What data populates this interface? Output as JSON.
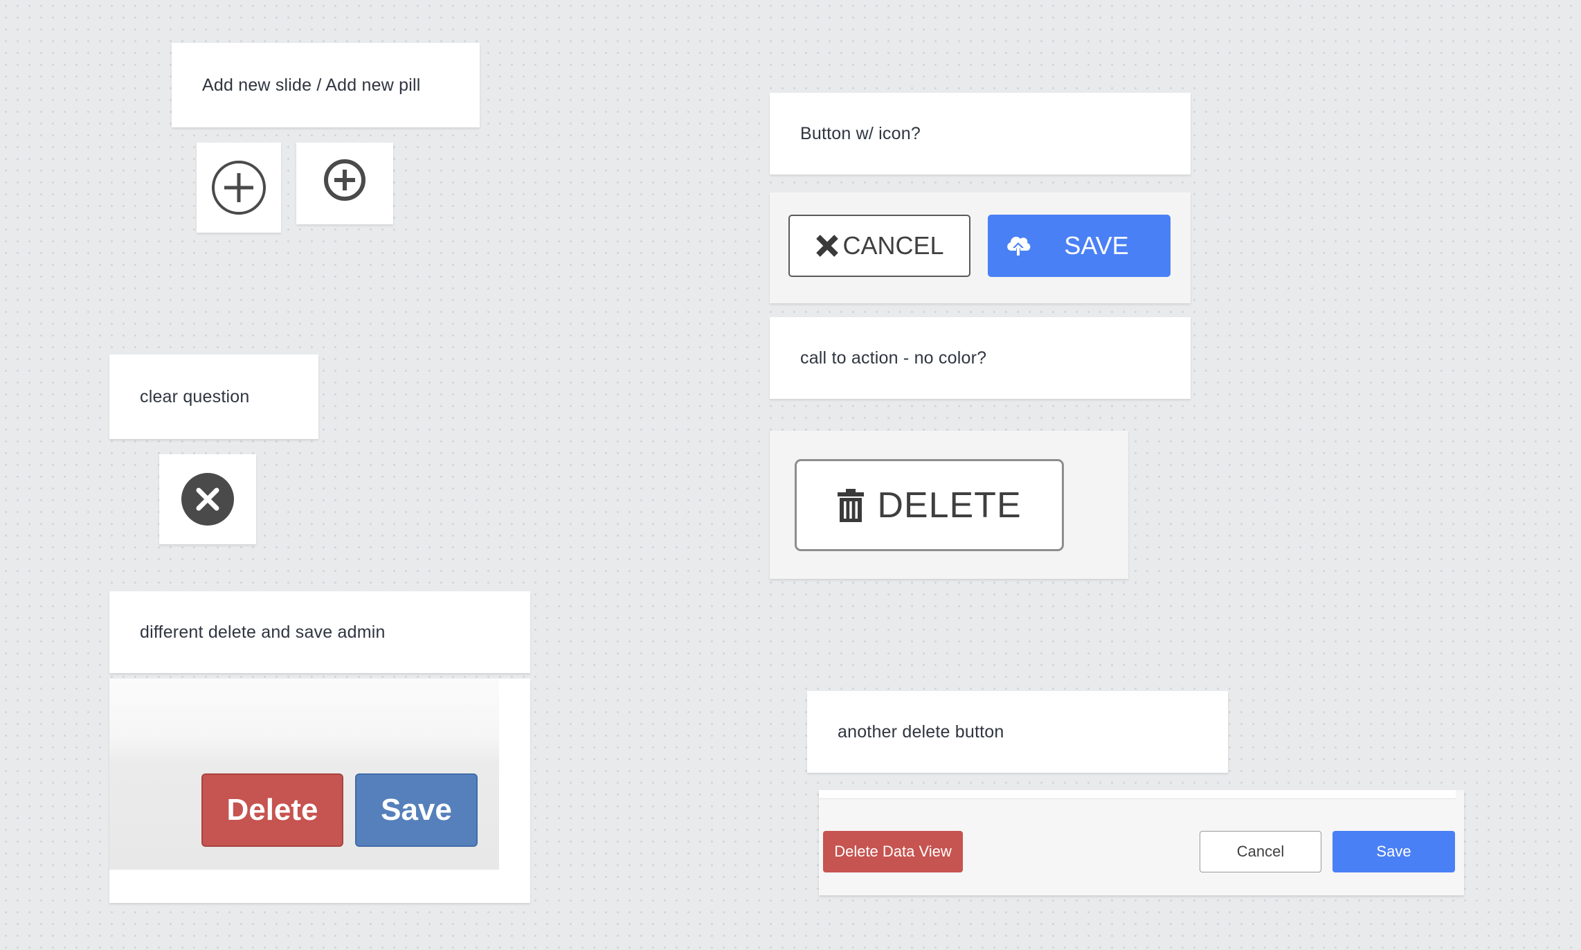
{
  "notes": {
    "add_slide": "Add new slide / Add new pill",
    "clear_question": "clear question",
    "different_delete_save": "different delete and save admin",
    "button_with_icon": "Button w/ icon?",
    "call_to_action": "call to action - no color?",
    "another_delete": "another delete button"
  },
  "icon_buttons": {
    "cancel_label": "CANCEL",
    "save_label": "SAVE",
    "cancel_icon": "x-mark-icon",
    "save_icon": "cloud-upload-icon"
  },
  "call_to_action": {
    "delete_label": "DELETE",
    "icon": "trash-icon"
  },
  "admin_buttons": {
    "delete_label": "Delete",
    "save_label": "Save"
  },
  "data_view_footer": {
    "delete_label": "Delete Data View",
    "cancel_label": "Cancel",
    "save_label": "Save"
  },
  "colors": {
    "canvas_bg": "#e9eaec",
    "primary_blue": "#4a80f5",
    "admin_blue": "#5680bb",
    "danger_red": "#c65450",
    "icon_dark": "#4a4a4a"
  }
}
